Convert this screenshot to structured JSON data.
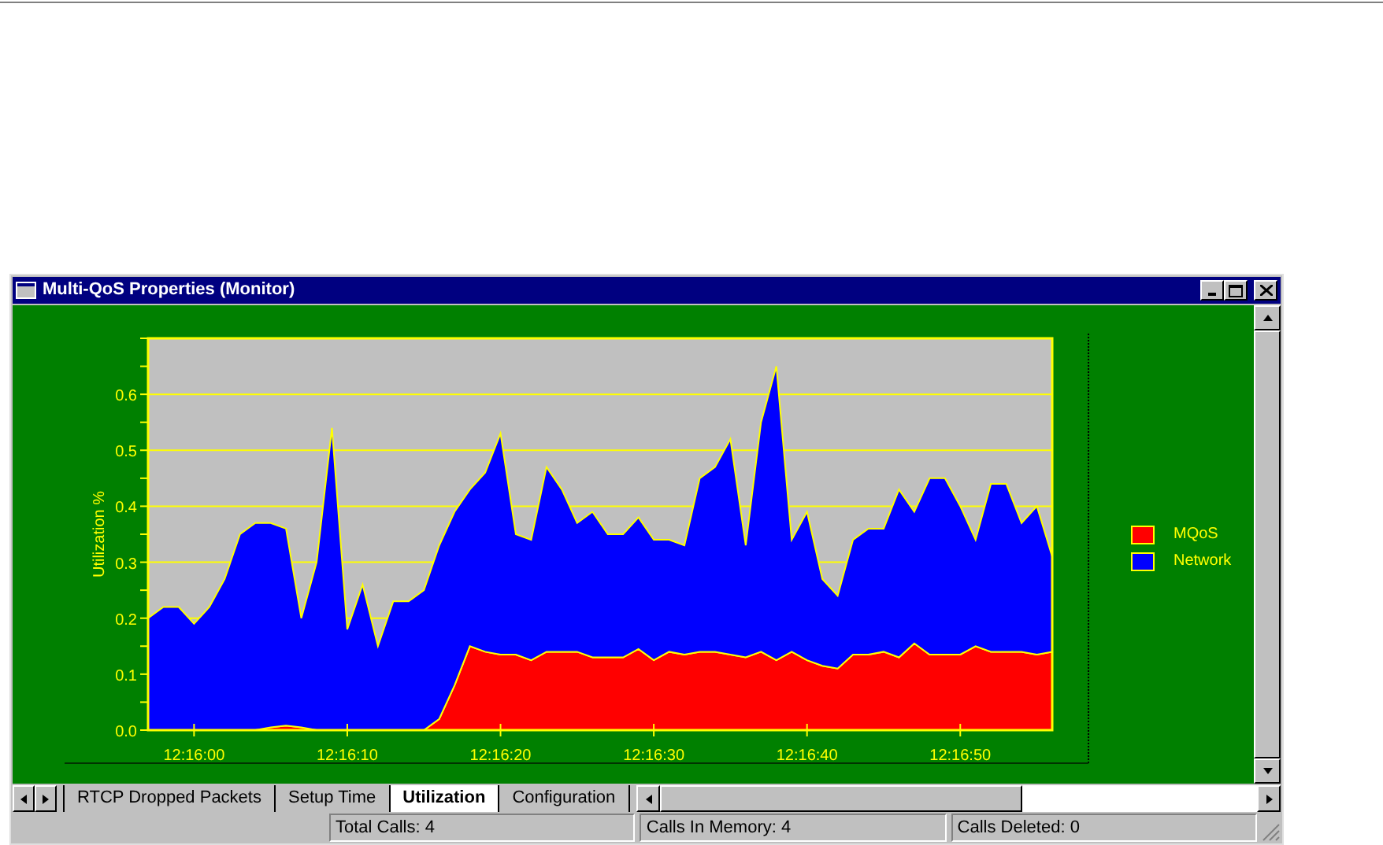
{
  "window": {
    "title": "Multi-QoS Properties (Monitor)"
  },
  "chart": {
    "chart_data": {
      "type": "area",
      "stacked": true,
      "ylabel": "Utilization %",
      "categories": [
        null,
        null,
        null,
        "12:16:00",
        null,
        null,
        null,
        null,
        null,
        null,
        null,
        null,
        null,
        "12:16:10",
        null,
        null,
        null,
        null,
        null,
        null,
        null,
        null,
        null,
        "12:16:20",
        null,
        null,
        null,
        null,
        null,
        null,
        null,
        null,
        null,
        "12:16:30",
        null,
        null,
        null,
        null,
        null,
        null,
        null,
        null,
        null,
        "12:16:40",
        null,
        null,
        null,
        null,
        null,
        null,
        null,
        null,
        null,
        "12:16:50",
        null,
        null,
        null,
        null,
        null,
        null
      ],
      "ylim": [
        0,
        0.7
      ],
      "grid": true,
      "yticks": [
        {
          "value": 0,
          "label": "0.0"
        },
        {
          "value": 0.1,
          "label": "0.1"
        },
        {
          "value": 0.2,
          "label": "0.2"
        },
        {
          "value": 0.3,
          "label": "0.3"
        },
        {
          "value": 0.4,
          "label": "0.4"
        },
        {
          "value": 0.5,
          "label": "0.5"
        },
        {
          "value": 0.6,
          "label": "0.6"
        }
      ],
      "series": [
        {
          "name": "MQoS",
          "color": "#ff0000",
          "values": [
            0,
            0,
            0,
            0,
            0,
            0,
            0,
            0,
            0.005,
            0.008,
            0.005,
            0,
            0,
            0,
            0,
            0,
            0,
            0,
            0,
            0.02,
            0.08,
            0.15,
            0.14,
            0.135,
            0.135,
            0.125,
            0.14,
            0.14,
            0.14,
            0.13,
            0.13,
            0.13,
            0.145,
            0.125,
            0.14,
            0.135,
            0.14,
            0.14,
            0.135,
            0.13,
            0.14,
            0.125,
            0.14,
            0.125,
            0.115,
            0.11,
            0.135,
            0.135,
            0.14,
            0.13,
            0.155,
            0.135,
            0.135,
            0.135,
            0.15,
            0.14,
            0.14,
            0.14,
            0.135,
            0.14
          ]
        },
        {
          "name": "Network",
          "color": "#0000ff",
          "values": [
            0.2,
            0.22,
            0.22,
            0.19,
            0.22,
            0.27,
            0.35,
            0.37,
            0.365,
            0.352,
            0.195,
            0.3,
            0.54,
            0.18,
            0.26,
            0.15,
            0.23,
            0.23,
            0.25,
            0.31,
            0.31,
            0.28,
            0.32,
            0.395,
            0.215,
            0.215,
            0.33,
            0.29,
            0.23,
            0.26,
            0.22,
            0.22,
            0.235,
            0.215,
            0.2,
            0.195,
            0.31,
            0.33,
            0.385,
            0.2,
            0.41,
            0.525,
            0.2,
            0.265,
            0.155,
            0.13,
            0.205,
            0.225,
            0.22,
            0.3,
            0.235,
            0.315,
            0.315,
            0.265,
            0.19,
            0.3,
            0.3,
            0.23,
            0.265,
            0.17
          ]
        }
      ]
    }
  },
  "tabs": [
    {
      "label": "RTCP Dropped Packets",
      "selected": false
    },
    {
      "label": "Setup Time",
      "selected": false
    },
    {
      "label": "Utilization",
      "selected": true
    },
    {
      "label": "Configuration",
      "selected": false
    }
  ],
  "status_bar": [
    "Total Calls: 4",
    "Calls In Memory: 4",
    "Calls Deleted: 0"
  ]
}
